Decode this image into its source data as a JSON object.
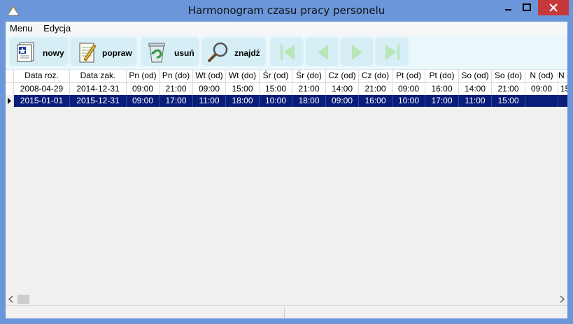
{
  "window": {
    "title": "Harmonogram czasu pracy personelu"
  },
  "menu": [
    "Menu",
    "Edycja"
  ],
  "toolbar": {
    "new_label": "nowy",
    "edit_label": "popraw",
    "delete_label": "usuń",
    "find_label": "znajdź"
  },
  "grid": {
    "columns": [
      "Data roz.",
      "Data zak.",
      "Pn (od)",
      "Pn (do)",
      "Wt (od)",
      "Wt (do)",
      "Śr (od)",
      "Śr (do)",
      "Cz (od)",
      "Cz (do)",
      "Pt (od)",
      "Pt (do)",
      "So (od)",
      "So (do)",
      "N (od)",
      "N ("
    ],
    "rows": [
      [
        "2008-04-29",
        "2014-12-31",
        "09:00",
        "21:00",
        "09:00",
        "15:00",
        "15:00",
        "21:00",
        "14:00",
        "21:00",
        "09:00",
        "16:00",
        "14:00",
        "21:00",
        "09:00",
        "15"
      ],
      [
        "2015-01-01",
        "2015-12-31",
        "09:00",
        "17:00",
        "11:00",
        "18:00",
        "10:00",
        "18:00",
        "09:00",
        "16:00",
        "10:00",
        "17:00",
        "11:00",
        "15:00",
        "",
        ""
      ]
    ],
    "selected_row": 1
  },
  "colors": {
    "selection": "#0a1d78",
    "titlebar": "#6b96da",
    "close": "#c7383b"
  },
  "icons": [
    "app-icon",
    "new-record-icon",
    "edit-record-icon",
    "delete-record-icon",
    "find-icon",
    "first-record-icon",
    "prev-record-icon",
    "next-record-icon",
    "last-record-icon"
  ]
}
